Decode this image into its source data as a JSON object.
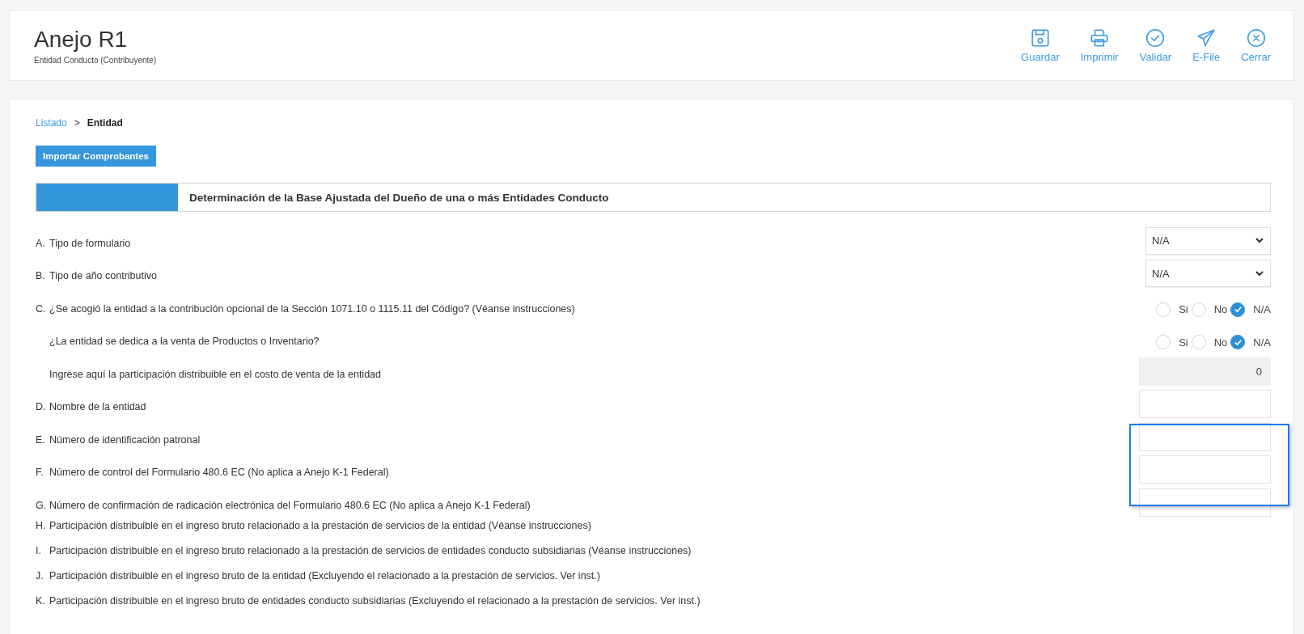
{
  "header": {
    "title": "Anejo R1",
    "subtitle": "Entidad Conducto (Contribuyente)",
    "actions": [
      {
        "kind": "save",
        "label": "Guardar"
      },
      {
        "kind": "print",
        "label": "Imprimir"
      },
      {
        "kind": "validate",
        "label": "Validar"
      },
      {
        "kind": "send",
        "label": "E-File"
      },
      {
        "kind": "close",
        "label": "Cerrar"
      }
    ]
  },
  "breadcrumb": [
    {
      "label": "Listado",
      "kind": "link"
    },
    {
      "label": ">",
      "kind": "separator"
    },
    {
      "label": "Entidad",
      "kind": "current"
    }
  ],
  "import_button": "Importar Comprobantes",
  "section_title": "Determinación de la Base Ajustada del Dueño de una o más Entidades Conducto",
  "rows": [
    {
      "letter": "A.",
      "label": "Tipo de formulario",
      "control": {
        "kind": "select",
        "value": "N/A"
      }
    },
    {
      "letter": "B.",
      "label": "Tipo de año contributivo",
      "control": {
        "kind": "select",
        "value": "N/A"
      }
    },
    {
      "letter": "C.",
      "label": "¿Se acogió la entidad a la contribución opcional de la Sección 1071.10 o 1115.11 del Código? (Véanse instrucciones)",
      "control": {
        "kind": "radio",
        "options": [
          {
            "label": "Si",
            "selected": false
          },
          {
            "label": "No",
            "selected": false
          },
          {
            "label": "N/A",
            "selected": true
          }
        ]
      }
    },
    {
      "label": "¿La entidad se dedica a la venta de Productos o Inventario?",
      "control": {
        "kind": "radio",
        "options": [
          {
            "label": "Si",
            "selected": false
          },
          {
            "label": "No",
            "selected": false
          },
          {
            "label": "N/A",
            "selected": true
          }
        ]
      }
    },
    {
      "label": "Ingrese aquí la participación distribuible en el costo de venta de la entidad",
      "control": {
        "kind": "input",
        "value": "0",
        "disabled": true
      }
    },
    {
      "letter": "D.",
      "label": "Nombre de la entidad",
      "control": {
        "kind": "input",
        "disabled": false
      }
    },
    {
      "letter": "E.",
      "label": "Número de identificación patronal",
      "control": {
        "kind": "input",
        "disabled": false
      }
    },
    {
      "letter": "F.",
      "label": "Número de control del Formulario 480.6 EC (No aplica a Anejo K-1 Federal)",
      "control": {
        "kind": "input",
        "disabled": false
      }
    },
    {
      "letter": "G.",
      "label": "Número de confirmación de radicación electrónica del Formulario 480.6 EC (No aplica a Anejo K-1 Federal)",
      "control": {
        "kind": "input",
        "disabled": false
      }
    },
    {
      "letter": "H.",
      "label": "Participación distribuible en el ingreso bruto relacionado a la prestación de servicios de la entidad (Véanse instrucciones)"
    },
    {
      "letter": "I.",
      "label": "Participación distribuible en el ingreso bruto relacionado a la prestación de servicios de entidades conducto subsidiarias (Véanse instrucciones)"
    },
    {
      "letter": "J.",
      "label": "Participación distribuible en el ingreso bruto de la entidad (Excluyendo el relacionado a la prestación de servicios. Ver inst.)"
    },
    {
      "letter": "K.",
      "label": "Participación distribuible en el ingreso bruto de entidades conducto subsidiarias (Excluyendo el relacionado a la prestación de servicios. Ver inst.)"
    }
  ]
}
